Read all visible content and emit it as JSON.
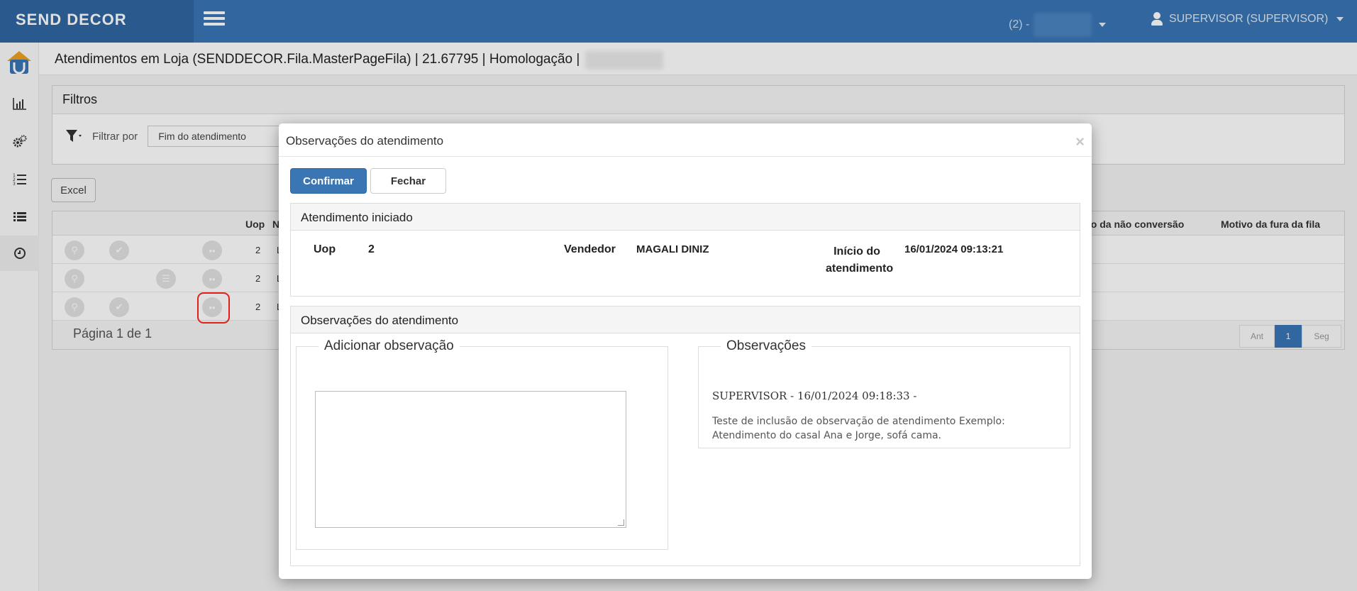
{
  "app": {
    "brand": "SEND DECOR"
  },
  "topbar": {
    "store_label": "(2) -",
    "user_label": "SUPERVISOR (SUPERVISOR)"
  },
  "sidebar": {
    "items": [
      {
        "icon": "chart-icon"
      },
      {
        "icon": "gears-icon"
      },
      {
        "icon": "ordered-list-icon"
      },
      {
        "icon": "list-icon"
      },
      {
        "icon": "clock-icon"
      }
    ]
  },
  "page": {
    "title": "Atendimentos em Loja (SENDDECOR.Fila.MasterPageFila) | 21.67795 | Homologação |"
  },
  "filters": {
    "title": "Filtros",
    "filter_by_label": "Filtrar por",
    "filter_by_value": "Fim do atendimento"
  },
  "excel_button": "Excel",
  "grid": {
    "columns": {
      "uop": "Uop",
      "n": "N",
      "motivo_nao_conversao": "vo da não conversão",
      "motivo_fura_fila": "Motivo da fura da fila"
    },
    "rows": [
      {
        "uop": "2",
        "n": "L"
      },
      {
        "uop": "2",
        "n": "L"
      },
      {
        "uop": "2",
        "n": "L"
      }
    ],
    "footer": "Página 1 de 1",
    "pager": {
      "prev": "Ant",
      "current": "1",
      "next": "Seg"
    }
  },
  "modal": {
    "title": "Observações do atendimento",
    "close": "×",
    "confirm_label": "Confirmar",
    "close_label": "Fechar",
    "started_panel": {
      "title": "Atendimento iniciado",
      "uop_label": "Uop",
      "uop_value": "2",
      "seller_label": "Vendedor",
      "seller_value": "MAGALI DINIZ",
      "start_label": "Início do atendimento",
      "start_value": "16/01/2024 09:13:21"
    },
    "obs_panel": {
      "title": "Observações do atendimento",
      "add_legend": "Adicionar observação",
      "textarea_value": "",
      "list_legend": "Observações",
      "entries": [
        {
          "header": "SUPERVISOR - 16/01/2024 09:18:33 -",
          "text": "Teste de inclusão de observação de atendimento Exemplo: Atendimento do casal Ana e Jorge, sofá cama."
        }
      ]
    }
  }
}
